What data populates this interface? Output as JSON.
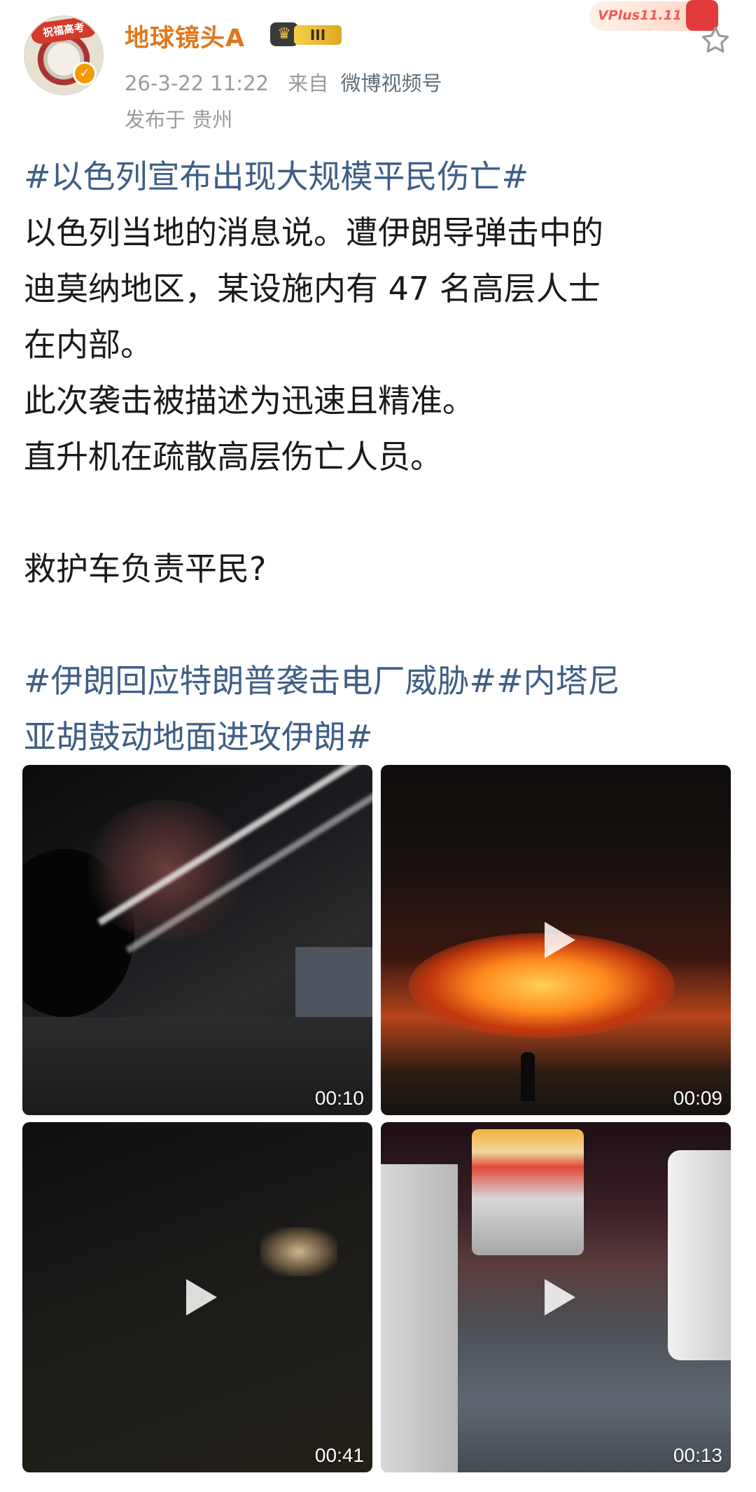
{
  "header": {
    "avatar_banner": "祝福高考",
    "verified_icon": "verified-badge-icon",
    "username": "地球镜头A",
    "vip_level": "III",
    "time": "26-3-22 11:22",
    "source_prefix": "来自",
    "source": "微博视频号",
    "location": "发布于 贵州",
    "promo_label": "VPlus11.11",
    "favorite_icon": "star-outline-icon"
  },
  "post": {
    "line1": "#以色列宣布出现大规模平民伤亡#",
    "line2": "以色列当地的消息说。遭伊朗导弹击中的",
    "line3": "迪莫纳地区，某设施内有 47 名高层人士",
    "line4": "在内部。",
    "line5": "此次袭击被描述为迅速且精准。",
    "line6": "直升机在疏散高层伤亡人员。",
    "line7": "",
    "line8": "救护车负责平民?",
    "line9": "",
    "line10": "#伊朗回应特朗普袭击电厂威胁##内塔尼",
    "line11": "亚胡鼓动地面进攻伊朗#"
  },
  "videos": [
    {
      "duration": "00:10"
    },
    {
      "duration": "00:09"
    },
    {
      "duration": "00:41"
    },
    {
      "duration": "00:13"
    }
  ],
  "colors": {
    "username": "#e0771c",
    "hashtag": "#3e5e86",
    "meta": "#9a9a9a"
  }
}
